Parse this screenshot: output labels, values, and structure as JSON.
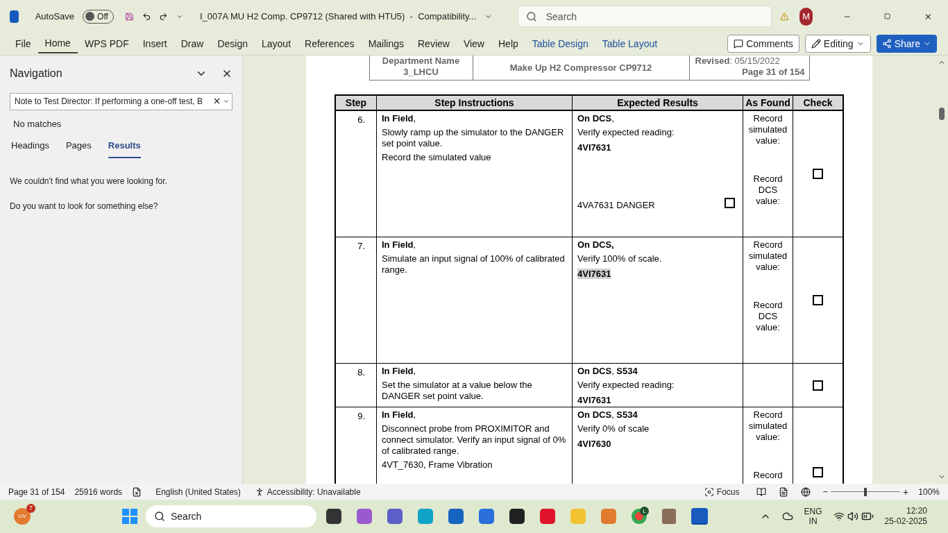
{
  "titlebar": {
    "autosave_label": "AutoSave",
    "autosave_state": "Off",
    "autosave_on": false,
    "doc_title": "I_007A MU H2 Comp. CP9712 (Shared with HTU5)  -  Compatibility...",
    "search_placeholder": "Search",
    "avatar": "M"
  },
  "ribbon_tabs": [
    {
      "label": "File",
      "selected": false,
      "kind": "plain"
    },
    {
      "label": "Home",
      "selected": true,
      "kind": "plain"
    },
    {
      "label": "WPS PDF",
      "selected": false,
      "kind": "plain"
    },
    {
      "label": "Insert",
      "selected": false,
      "kind": "plain"
    },
    {
      "label": "Draw",
      "selected": false,
      "kind": "plain"
    },
    {
      "label": "Design",
      "selected": false,
      "kind": "plain"
    },
    {
      "label": "Layout",
      "selected": false,
      "kind": "plain"
    },
    {
      "label": "References",
      "selected": false,
      "kind": "plain"
    },
    {
      "label": "Mailings",
      "selected": false,
      "kind": "plain"
    },
    {
      "label": "Review",
      "selected": false,
      "kind": "plain"
    },
    {
      "label": "View",
      "selected": false,
      "kind": "plain"
    },
    {
      "label": "Help",
      "selected": false,
      "kind": "plain"
    },
    {
      "label": "Table Design",
      "selected": false,
      "kind": "context"
    },
    {
      "label": "Table Layout",
      "selected": false,
      "kind": "context"
    }
  ],
  "ribbon_buttons": {
    "comments": "Comments",
    "editing": "Editing",
    "share": "Share"
  },
  "navigation": {
    "title": "Navigation",
    "search_value": "Note to Test Director: If performing a one-off test, B",
    "status": "No matches",
    "tabs": [
      {
        "label": "Headings",
        "selected": false
      },
      {
        "label": "Pages",
        "selected": false
      },
      {
        "label": "Results",
        "selected": true
      }
    ],
    "messages": [
      "We couldn't find what you were looking for.",
      "Do you want to look for something else?"
    ]
  },
  "doc_header": {
    "department": [
      "Department Name",
      "3_LHCU"
    ],
    "equipment": "Make Up H2 Compressor CP9712",
    "revised": "**Revised**: 05/15/2022",
    "page": "Page 31 of 154"
  },
  "table": {
    "columns": [
      "Step",
      "Step Instructions",
      "Expected Results",
      "As Found",
      "Check"
    ],
    "rows": [
      {
        "step": "6.",
        "instructions": [
          "**In Field**,",
          "Slowly ramp up the simulator to the DANGER set point value.",
          "Record the simulated value"
        ],
        "expected": [
          {
            "kind": "text",
            "text": "**On DCS**,"
          },
          {
            "kind": "text",
            "text": "Verify expected reading:"
          },
          {
            "kind": "tag",
            "text": "4VI7631",
            "highlighted": false
          },
          {
            "kind": "checkline",
            "text": "4VA7631 DANGER",
            "checked": false
          }
        ],
        "as_found": [
          [
            "Record",
            "simulated",
            "value:"
          ],
          [
            "Record",
            "DCS",
            "value:"
          ]
        ],
        "checked": false
      },
      {
        "step": "7.",
        "instructions": [
          "**In Field**,",
          "Simulate an input signal of 100% of calibrated range."
        ],
        "expected": [
          {
            "kind": "text",
            "text": "**On DCS,**"
          },
          {
            "kind": "text",
            "text": "Verify 100% of scale."
          },
          {
            "kind": "tag",
            "text": "4VI7631",
            "highlighted": true
          }
        ],
        "as_found": [
          [
            "Record",
            "simulated",
            "value:"
          ],
          [
            "Record",
            "DCS",
            "value:"
          ]
        ],
        "checked": false
      },
      {
        "step": "8.",
        "instructions": [
          "**In Field**,",
          "Set the simulator at a value below the DANGER set point value."
        ],
        "expected": [
          {
            "kind": "text",
            "text": "**On DCS**, **S534**"
          },
          {
            "kind": "text",
            "text": "Verify expected reading:"
          },
          {
            "kind": "tag",
            "text": "4VI7631",
            "highlighted": false
          }
        ],
        "as_found": [],
        "checked": false
      },
      {
        "step": "9.",
        "instructions": [
          "**In Field**,",
          "Disconnect probe from PROXIMITOR and connect simulator. Verify an input signal of 0% of calibrated range.",
          "4VT_7630, Frame Vibration"
        ],
        "expected": [
          {
            "kind": "text",
            "text": "**On DCS**, **S534**"
          },
          {
            "kind": "text",
            "text": "Verify 0% of scale"
          },
          {
            "kind": "tag",
            "text": "4VI7630",
            "highlighted": false
          }
        ],
        "as_found": [
          [
            "Record",
            "simulated",
            "value:"
          ],
          [
            "Record"
          ]
        ],
        "checked": false
      }
    ]
  },
  "status_bar": {
    "page": "Page 31 of 154",
    "words": "25916 words",
    "language": "English (United States)",
    "accessibility": "Accessibility: Unavailable",
    "focus": "Focus",
    "zoom_out": "−",
    "zoom_slider": {
      "level": 0.5
    },
    "zoom_in": "+",
    "zoom": "100%"
  },
  "taskbar": {
    "weather_badge": "7",
    "weather_avatar": "UV",
    "search_placeholder": "Search",
    "chrome_badge": "L",
    "lang": [
      "ENG",
      "IN"
    ],
    "time": "12:20",
    "date": "25-02-2025"
  }
}
